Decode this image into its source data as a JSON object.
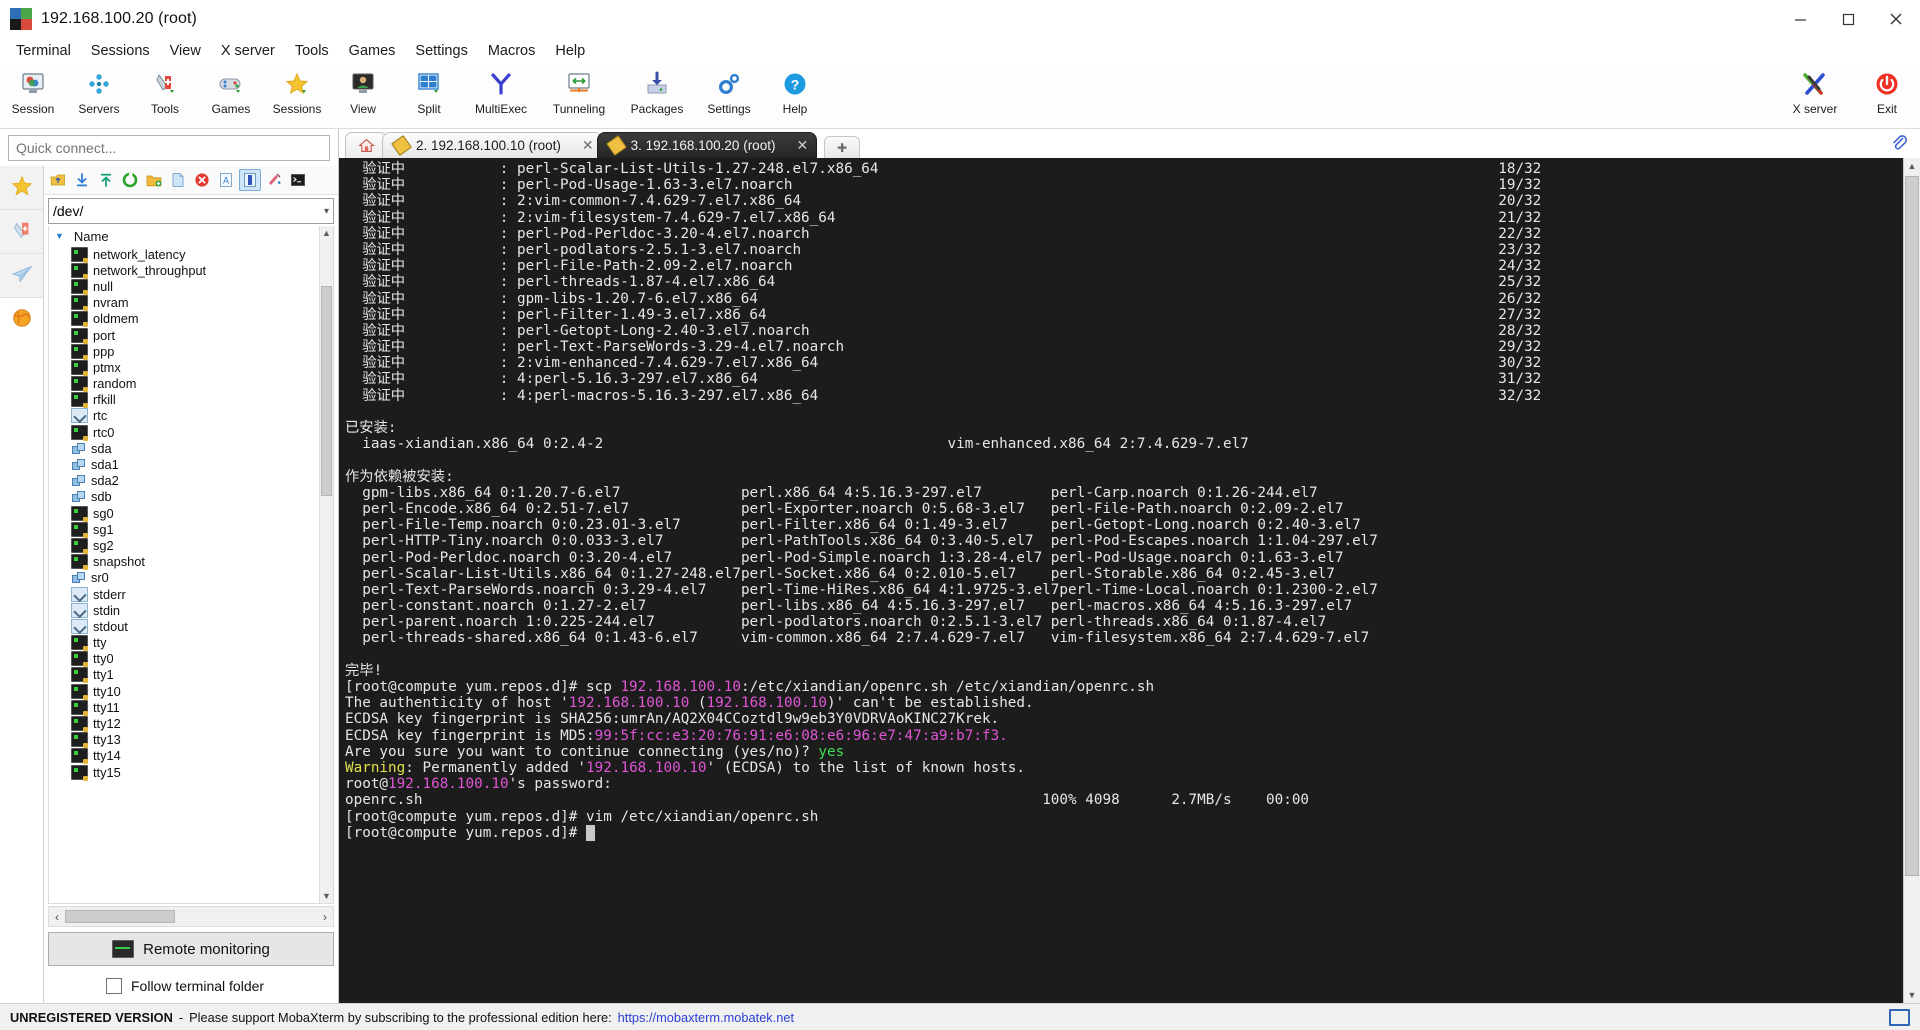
{
  "window": {
    "title": "192.168.100.20 (root)",
    "minimize_label": "Minimize",
    "maximize_label": "Maximize",
    "close_label": "Close"
  },
  "menubar": {
    "items": [
      "Terminal",
      "Sessions",
      "View",
      "X server",
      "Tools",
      "Games",
      "Settings",
      "Macros",
      "Help"
    ]
  },
  "toolbar": {
    "items": [
      {
        "label": "Session",
        "icon": "session-icon"
      },
      {
        "label": "Servers",
        "icon": "servers-icon"
      },
      {
        "label": "Tools",
        "icon": "tools-icon"
      },
      {
        "label": "Games",
        "icon": "games-icon"
      },
      {
        "label": "Sessions",
        "icon": "sessions-star-icon"
      },
      {
        "label": "View",
        "icon": "view-icon"
      },
      {
        "label": "Split",
        "icon": "split-icon"
      },
      {
        "label": "MultiExec",
        "icon": "multiexec-icon"
      },
      {
        "label": "Tunneling",
        "icon": "tunneling-icon"
      },
      {
        "label": "Packages",
        "icon": "packages-icon"
      },
      {
        "label": "Settings",
        "icon": "settings-gear-icon"
      },
      {
        "label": "Help",
        "icon": "help-icon"
      }
    ],
    "right_items": [
      {
        "label": "X server",
        "icon": "x-server-icon"
      },
      {
        "label": "Exit",
        "icon": "exit-power-icon"
      }
    ]
  },
  "sidebar": {
    "quick_connect_placeholder": "Quick connect...",
    "vtabs": [
      "favorites-star-icon",
      "tools-knife-icon",
      "sftp-paperplane-icon",
      "globe-icon"
    ],
    "browser_toolbar": [
      "go-up-icon",
      "download-icon",
      "upload-icon",
      "refresh-icon",
      "new-folder-icon",
      "new-file-icon",
      "delete-icon",
      "text-mode-icon",
      "binary-mode-icon",
      "permissions-icon",
      "terminal-icon"
    ],
    "path": "/dev/",
    "column_header": "Name",
    "files": [
      {
        "name": "network_latency",
        "type": "device"
      },
      {
        "name": "network_throughput",
        "type": "device"
      },
      {
        "name": "null",
        "type": "device"
      },
      {
        "name": "nvram",
        "type": "device"
      },
      {
        "name": "oldmem",
        "type": "device"
      },
      {
        "name": "port",
        "type": "device"
      },
      {
        "name": "ppp",
        "type": "device"
      },
      {
        "name": "ptmx",
        "type": "device"
      },
      {
        "name": "random",
        "type": "device"
      },
      {
        "name": "rfkill",
        "type": "device"
      },
      {
        "name": "rtc",
        "type": "link"
      },
      {
        "name": "rtc0",
        "type": "device"
      },
      {
        "name": "sda",
        "type": "block"
      },
      {
        "name": "sda1",
        "type": "block"
      },
      {
        "name": "sda2",
        "type": "block"
      },
      {
        "name": "sdb",
        "type": "block"
      },
      {
        "name": "sg0",
        "type": "device"
      },
      {
        "name": "sg1",
        "type": "device"
      },
      {
        "name": "sg2",
        "type": "device"
      },
      {
        "name": "snapshot",
        "type": "device"
      },
      {
        "name": "sr0",
        "type": "block"
      },
      {
        "name": "stderr",
        "type": "link"
      },
      {
        "name": "stdin",
        "type": "link"
      },
      {
        "name": "stdout",
        "type": "link"
      },
      {
        "name": "tty",
        "type": "device"
      },
      {
        "name": "tty0",
        "type": "device"
      },
      {
        "name": "tty1",
        "type": "device"
      },
      {
        "name": "tty10",
        "type": "device"
      },
      {
        "name": "tty11",
        "type": "device"
      },
      {
        "name": "tty12",
        "type": "device"
      },
      {
        "name": "tty13",
        "type": "device"
      },
      {
        "name": "tty14",
        "type": "device"
      },
      {
        "name": "tty15",
        "type": "device"
      }
    ],
    "remote_monitoring_label": "Remote monitoring",
    "follow_terminal_folder_label": "Follow terminal folder",
    "follow_terminal_folder_checked": false
  },
  "tabs": {
    "home_label": "home-tab",
    "new_tab_label": "+",
    "items": [
      {
        "label": "2. 192.168.100.10 (root)",
        "active": false
      },
      {
        "label": "3. 192.168.100.20 (root)",
        "active": true
      }
    ]
  },
  "terminal": {
    "verify_label": "验证中",
    "verify_lines": [
      {
        "pkg": "perl-Scalar-List-Utils-1.27-248.el7.x86_64",
        "count": "18/32"
      },
      {
        "pkg": "perl-Pod-Usage-1.63-3.el7.noarch",
        "count": "19/32"
      },
      {
        "pkg": "2:vim-common-7.4.629-7.el7.x86_64",
        "count": "20/32"
      },
      {
        "pkg": "2:vim-filesystem-7.4.629-7.el7.x86_64",
        "count": "21/32"
      },
      {
        "pkg": "perl-Pod-Perldoc-3.20-4.el7.noarch",
        "count": "22/32"
      },
      {
        "pkg": "perl-podlators-2.5.1-3.el7.noarch",
        "count": "23/32"
      },
      {
        "pkg": "perl-File-Path-2.09-2.el7.noarch",
        "count": "24/32"
      },
      {
        "pkg": "perl-threads-1.87-4.el7.x86_64",
        "count": "25/32"
      },
      {
        "pkg": "gpm-libs-1.20.7-6.el7.x86_64",
        "count": "26/32"
      },
      {
        "pkg": "perl-Filter-1.49-3.el7.x86_64",
        "count": "27/32"
      },
      {
        "pkg": "perl-Getopt-Long-2.40-3.el7.noarch",
        "count": "28/32"
      },
      {
        "pkg": "perl-Text-ParseWords-3.29-4.el7.noarch",
        "count": "29/32"
      },
      {
        "pkg": "2:vim-enhanced-7.4.629-7.el7.x86_64",
        "count": "30/32"
      },
      {
        "pkg": "4:perl-5.16.3-297.el7.x86_64",
        "count": "31/32"
      },
      {
        "pkg": "4:perl-macros-5.16.3-297.el7.x86_64",
        "count": "32/32"
      }
    ],
    "installed_header": "已安装:",
    "installed": [
      {
        "col1": "iaas-xiandian.x86_64 0:2.4-2",
        "col2": "vim-enhanced.x86_64 2:7.4.629-7.el7",
        "col3": ""
      }
    ],
    "dependency_header": "作为依赖被安装:",
    "dependencies": [
      {
        "col1": "gpm-libs.x86_64 0:1.20.7-6.el7",
        "col2": "perl.x86_64 4:5.16.3-297.el7",
        "col3": "perl-Carp.noarch 0:1.26-244.el7"
      },
      {
        "col1": "perl-Encode.x86_64 0:2.51-7.el7",
        "col2": "perl-Exporter.noarch 0:5.68-3.el7",
        "col3": "perl-File-Path.noarch 0:2.09-2.el7"
      },
      {
        "col1": "perl-File-Temp.noarch 0:0.23.01-3.el7",
        "col2": "perl-Filter.x86_64 0:1.49-3.el7",
        "col3": "perl-Getopt-Long.noarch 0:2.40-3.el7"
      },
      {
        "col1": "perl-HTTP-Tiny.noarch 0:0.033-3.el7",
        "col2": "perl-PathTools.x86_64 0:3.40-5.el7",
        "col3": "perl-Pod-Escapes.noarch 1:1.04-297.el7"
      },
      {
        "col1": "perl-Pod-Perldoc.noarch 0:3.20-4.el7",
        "col2": "perl-Pod-Simple.noarch 1:3.28-4.el7",
        "col3": "perl-Pod-Usage.noarch 0:1.63-3.el7"
      },
      {
        "col1": "perl-Scalar-List-Utils.x86_64 0:1.27-248.el7",
        "col2": "perl-Socket.x86_64 0:2.010-5.el7",
        "col3": "perl-Storable.x86_64 0:2.45-3.el7"
      },
      {
        "col1": "perl-Text-ParseWords.noarch 0:3.29-4.el7",
        "col2": "perl-Time-HiRes.x86_64 4:1.9725-3.el7",
        "col3": "perl-Time-Local.noarch 0:1.2300-2.el7"
      },
      {
        "col1": "perl-constant.noarch 0:1.27-2.el7",
        "col2": "perl-libs.x86_64 4:5.16.3-297.el7",
        "col3": "perl-macros.x86_64 4:5.16.3-297.el7"
      },
      {
        "col1": "perl-parent.noarch 1:0.225-244.el7",
        "col2": "perl-podlators.noarch 0:2.5.1-3.el7",
        "col3": "perl-threads.x86_64 0:1.87-4.el7"
      },
      {
        "col1": "perl-threads-shared.x86_64 0:1.43-6.el7",
        "col2": "vim-common.x86_64 2:7.4.629-7.el7",
        "col3": "vim-filesystem.x86_64 2:7.4.629-7.el7"
      }
    ],
    "complete_label": "完毕!",
    "prompt": "[root@compute yum.repos.d]#",
    "scp_command": " scp ",
    "scp_host": "192.168.100.10",
    "scp_rest": ":/etc/xiandian/openrc.sh /etc/xiandian/openrc.sh",
    "auth_pre": "The authenticity of host '",
    "auth_host1": "192.168.100.10",
    "auth_mid": " (",
    "auth_host2": "192.168.100.10",
    "auth_post": ")' can't be established.",
    "fp_sha_label": "ECDSA key fingerprint is SHA256:",
    "fp_sha_value": "umrAn/AQ2X04CCoztdl9w9eb3Y0VDRVAoKINC27Krek.",
    "fp_md5_label": "ECDSA key fingerprint is MD5:",
    "fp_md5_value": "99:5f:cc:e3:20:76:91:e6:08:e6:96:e7:47:a9:b7:f3.",
    "confirm_question": "Are you sure you want to continue connecting (yes/no)? ",
    "confirm_answer": "yes",
    "warning_label": "Warning",
    "warning_pre": ": Permanently added '",
    "warning_host": "192.168.100.10",
    "warning_post": "' (ECDSA) to the list of known hosts.",
    "password_pre": "root@",
    "password_host": "192.168.100.10",
    "password_post": "'s password:",
    "transfer_file": "openrc.sh",
    "transfer_percent": "100%",
    "transfer_size": "4098",
    "transfer_speed": "2.7MB/s",
    "transfer_time": "00:00",
    "vim_command": " vim /etc/xiandian/openrc.sh",
    "final_prompt": "[root@compute yum.repos.d]#"
  },
  "statusbar": {
    "unregistered": "UNREGISTERED VERSION",
    "dash": "-",
    "message": "Please support MobaXterm by subscribing to the professional edition here:",
    "link": "https://mobaxterm.mobatek.net"
  },
  "colors": {
    "magenta": "#e055d6",
    "green": "#3ddc55",
    "yellow": "#dfe04a",
    "terminal_bg": "#1c1c1c",
    "terminal_fg": "#e6e6e6",
    "accent_blue": "#2b3fd4"
  }
}
